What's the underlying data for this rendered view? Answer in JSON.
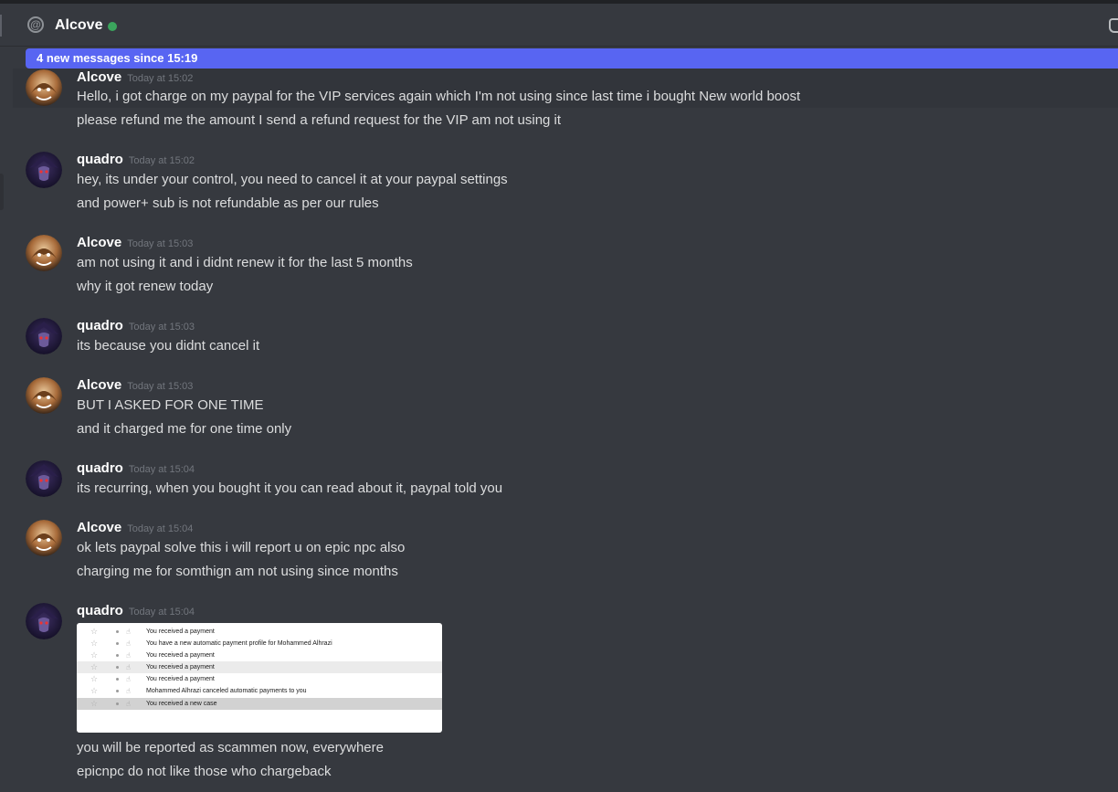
{
  "header": {
    "channel_name": "Alcove",
    "status_color": "#3ba55d",
    "icon": "at-icon"
  },
  "new_messages_bar": {
    "text": "4 new messages since 15:19"
  },
  "messages": [
    {
      "author": "Alcove",
      "timestamp": "Today at 15:02",
      "lines": [
        "Hello, i got charge on my paypal for the VIP services again which I'm not using since last time i bought New world boost",
        "please refund me the amount I send a refund request for the VIP am not using it"
      ]
    },
    {
      "author": "quadro",
      "timestamp": "Today at 15:02",
      "lines": [
        "hey, its under your control, you need to cancel it at your paypal settings",
        "and power+ sub is not refundable as per our rules"
      ]
    },
    {
      "author": "Alcove",
      "timestamp": "Today at 15:03",
      "lines": [
        "am not using it and i didnt renew it for the last 5 months",
        "why it got renew today"
      ]
    },
    {
      "author": "quadro",
      "timestamp": "Today at 15:03",
      "lines": [
        "its because you didnt cancel it"
      ]
    },
    {
      "author": "Alcove",
      "timestamp": "Today at 15:03",
      "lines": [
        "BUT I ASKED FOR ONE TIME",
        "and it charged me for one time only"
      ]
    },
    {
      "author": "quadro",
      "timestamp": "Today at 15:04",
      "lines": [
        "its recurring, when you bought it you can read about it, paypal told you"
      ]
    },
    {
      "author": "Alcove",
      "timestamp": "Today at 15:04",
      "lines": [
        "ok lets paypal solve this i will report u on epic npc also",
        "charging me for somthign am not using since months"
      ]
    },
    {
      "author": "quadro",
      "timestamp": "Today at 15:04",
      "lines": [
        "you will be reported as scammen now, everywhere",
        "epicnpc do not like those who chargeback"
      ]
    }
  ],
  "attachment": {
    "rows": [
      "You received a payment",
      "You have a new automatic payment profile for Mohammed Alhrazi",
      "You received a payment",
      "You received a payment",
      "You received a payment",
      "Mohammed Alhrazi canceled automatic payments to you",
      "You received a new case"
    ]
  },
  "colors": {
    "alcove_name": "#ffffff",
    "quadro_name": "#ffffff",
    "accent": "#5865f2",
    "background": "#36393f"
  }
}
